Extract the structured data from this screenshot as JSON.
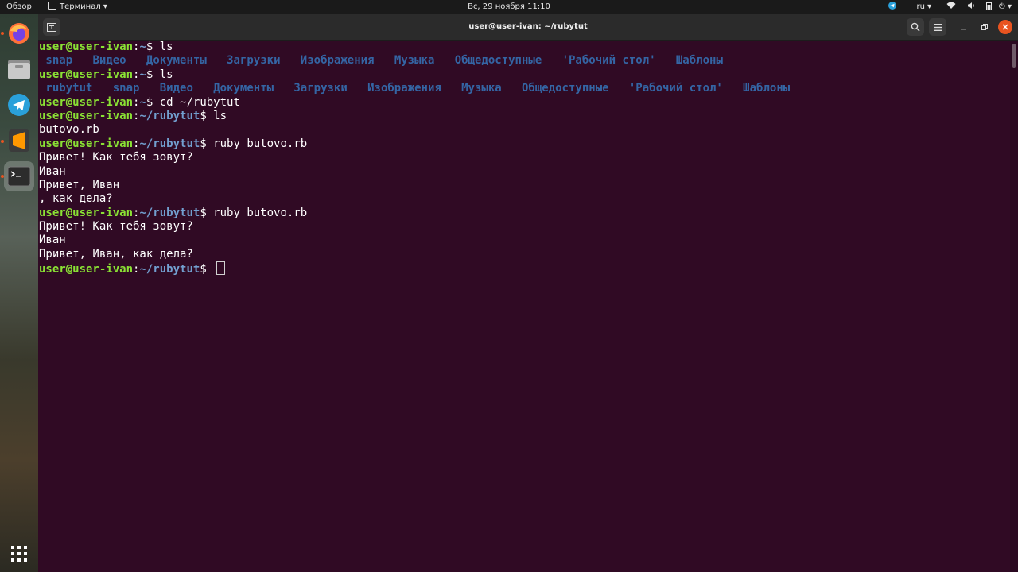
{
  "topbar": {
    "activities": "Обзор",
    "app_menu": "Терминал ▾",
    "clock": "Вс, 29 ноября  11:10",
    "lang": "ru ▾",
    "power": "⏻ ▾"
  },
  "dock": {
    "apps": [
      "firefox-icon",
      "files-icon",
      "telegram-icon",
      "sublime-text-icon",
      "terminal-icon"
    ],
    "show_apps": "show-applications-icon"
  },
  "window": {
    "title": "user@user-ivan: ~/rubytut"
  },
  "terminal": {
    "lines": [
      {
        "type": "cmd",
        "user": "user@user-ivan",
        "path": "~",
        "cmd": " ls"
      },
      {
        "type": "ls",
        "entries": [
          " snap",
          "Видео",
          "Документы",
          "Загрузки",
          "Изображения",
          "Музыка",
          "Общедоступные",
          "'Рабочий стол'",
          "Шаблоны"
        ]
      },
      {
        "type": "cmd",
        "user": "user@user-ivan",
        "path": "~",
        "cmd": " ls"
      },
      {
        "type": "ls",
        "entries": [
          " rubytut",
          "snap",
          "Видео",
          "Документы",
          "Загрузки",
          "Изображения",
          "Музыка",
          "Общедоступные",
          "'Рабочий стол'",
          "Шаблоны"
        ]
      },
      {
        "type": "cmd",
        "user": "user@user-ivan",
        "path": "~",
        "cmd": " cd ~/rubytut"
      },
      {
        "type": "cmd",
        "user": "user@user-ivan",
        "path": "~/rubytut",
        "cmd": " ls"
      },
      {
        "type": "out",
        "text": "butovo.rb"
      },
      {
        "type": "cmd",
        "user": "user@user-ivan",
        "path": "~/rubytut",
        "cmd": " ruby butovo.rb"
      },
      {
        "type": "out",
        "text": "Привет! Как тебя зовут?"
      },
      {
        "type": "out",
        "text": "Иван"
      },
      {
        "type": "out",
        "text": "Привет, Иван"
      },
      {
        "type": "out",
        "text": ", как дела?"
      },
      {
        "type": "cmd",
        "user": "user@user-ivan",
        "path": "~/rubytut",
        "cmd": " ruby butovo.rb"
      },
      {
        "type": "out",
        "text": "Привет! Как тебя зовут?"
      },
      {
        "type": "out",
        "text": "Иван"
      },
      {
        "type": "out",
        "text": "Привет, Иван, как дела?"
      },
      {
        "type": "prompt",
        "user": "user@user-ivan",
        "path": "~/rubytut",
        "cmd": " "
      }
    ]
  }
}
